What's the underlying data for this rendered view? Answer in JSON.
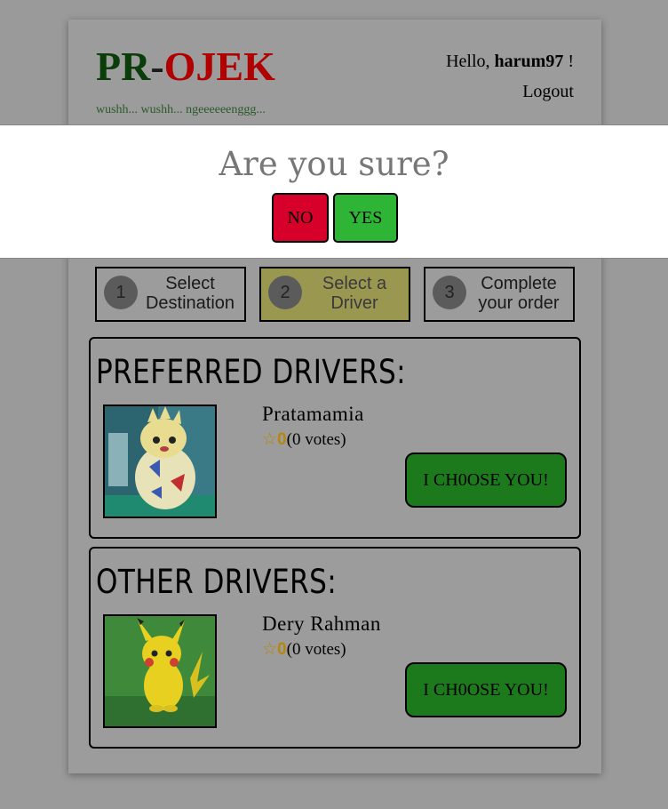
{
  "header": {
    "logo_pr": "PR",
    "logo_dash": "-",
    "logo_ojek": "OJEK",
    "tagline": "wushh... wushh... ngeeeeeenggg...",
    "hello_prefix": "Hello, ",
    "username": "harum97",
    "hello_suffix": " !",
    "logout": "Logout"
  },
  "steps": [
    {
      "number": "1",
      "label": "Select Destination",
      "active": false
    },
    {
      "number": "2",
      "label": "Select a Driver",
      "active": true
    },
    {
      "number": "3",
      "label": "Complete your order",
      "active": false
    }
  ],
  "preferred": {
    "title": "PREFERRED DRIVERS:",
    "driver": {
      "name": "Pratamamia",
      "star": "☆",
      "rating": "0",
      "votes": "(0 votes)",
      "button": "I CH0OSE YOU!",
      "photo_icon": "togepi-photo"
    }
  },
  "other": {
    "title": "OTHER DRIVERS:",
    "driver": {
      "name": "Dery Rahman",
      "star": "☆",
      "rating": "0",
      "votes": "(0 votes)",
      "button": "I CH0OSE YOU!",
      "photo_icon": "pikachu-photo"
    }
  },
  "dialog": {
    "question": "Are you sure?",
    "no": "NO",
    "yes": "YES"
  },
  "colors": {
    "logo_green": "#0b3d0b",
    "logo_red": "#b00000",
    "choose_button": "#1c7a1c",
    "no_button": "#d6002a",
    "yes_button": "#2fb536",
    "active_step": "#9a9850"
  }
}
